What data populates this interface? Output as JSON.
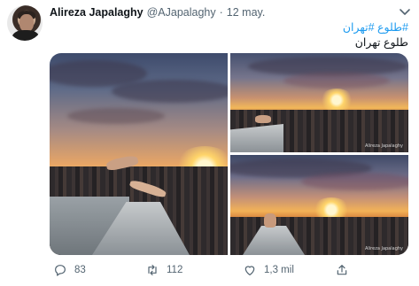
{
  "tweet": {
    "author_name": "Alireza Japalaghy",
    "author_handle": "@AJapalaghy",
    "separator": "·",
    "date": "12 may.",
    "hashtags": "#طلوع #تهران",
    "caption": "طلوع تهران",
    "images": [
      {
        "icon": "photo",
        "watermark": ""
      },
      {
        "icon": "photo",
        "watermark": "Alireza Japalaghy"
      },
      {
        "icon": "photo",
        "watermark": "Alireza Japalaghy"
      }
    ],
    "actions": {
      "reply_count": "83",
      "retweet_count": "112",
      "like_count": "1,3 mil",
      "share_icon": "share-icon"
    }
  },
  "colors": {
    "link": "#1d9bf0",
    "muted": "#536471",
    "text": "#0f1419"
  }
}
